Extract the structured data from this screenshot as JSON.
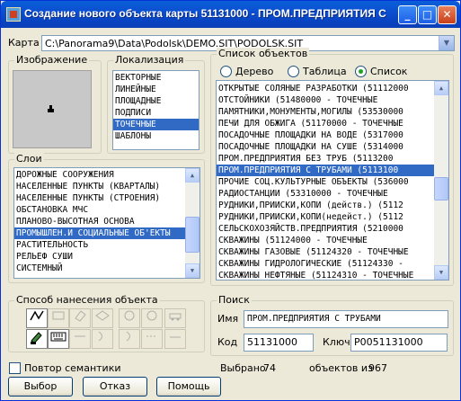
{
  "window": {
    "title": "Создание нового объекта карты 51131000 - ПРОМ.ПРЕДПРИЯТИЯ С ..."
  },
  "map": {
    "label": "Карта",
    "value": "C:\\Panorama9\\Data\\Podolsk\\DEMO.SIT\\PODOLSK.SIT"
  },
  "image_group": {
    "title": "Изображение"
  },
  "localization": {
    "title": "Локализация",
    "items": [
      "ВЕКТОРНЫЕ",
      "ЛИНЕЙНЫЕ",
      "ПЛОЩАДНЫЕ",
      "ПОДПИСИ",
      "ТОЧЕЧНЫЕ",
      "ШАБЛОНЫ"
    ],
    "selected_index": 4
  },
  "layers": {
    "title": "Слои",
    "items": [
      "ДОРОЖНЫЕ СООРУЖЕНИЯ",
      "НАСЕЛЕННЫЕ ПУНКТЫ (КВАРТАЛЫ)",
      "НАСЕЛЕННЫЕ ПУНКТЫ (СТРОЕНИЯ)",
      "ОБСТАНОВКА МЧС",
      "ПЛАНОВО-ВЫСОТНАЯ ОСНОВА",
      "ПРОМЫШЛЕН.И СОЦИАЛЬНЫЕ ОБ'ЕКТЫ",
      "РАСТИТЕЛЬНОСТЬ",
      "РЕЛЬЕФ СУШИ",
      "СИСТЕМНЫЙ"
    ],
    "selected_index": 5
  },
  "objects": {
    "title": "Список объектов",
    "radios": [
      "Дерево",
      "Таблица",
      "Список"
    ],
    "selected_radio": 2,
    "items": [
      "ОТКРЫТЫЕ СОЛЯНЫЕ РАЗРАБОТКИ (51112000",
      "ОТСТОЙНИКИ (51480000 - ТОЧЕЧНЫЕ",
      "ПАМЯТНИКИ,МОНУМЕНТЫ,МОГИЛЫ (53530000",
      "ПЕЧИ ДЛЯ ОБЖИГА (51170000 - ТОЧЕЧНЫЕ",
      "ПОСАДОЧНЫЕ ПЛОЩАДКИ НА ВОДЕ  (5317000",
      "ПОСАДОЧНЫЕ ПЛОЩАДКИ НА СУШЕ  (5314000",
      "ПРОМ.ПРЕДПРИЯТИЯ БЕЗ ТРУБ  (5113200",
      "ПРОМ.ПРЕДПРИЯТИЯ С ТРУБАМИ  (5113100",
      "ПРОЧИЕ СОЦ.КУЛЬТУРНЫЕ ОБЪЕКТЫ (536000",
      "РАДИОСТАНЦИИ   (53310000 - ТОЧЕЧНЫЕ",
      "РУДНИКИ,ПРИИСКИ,КОПИ (действ.) (5112",
      "РУДНИКИ,ПРИИСКИ,КОПИ(недейст.) (5112",
      "СЕЛЬСКОХОЗЯЙСТВ.ПРЕДПРИЯТИЯ (5210000",
      "СКВАЖИНЫ  (51124000 - ТОЧЕЧНЫЕ",
      "СКВАЖИНЫ ГАЗОВЫЕ  (51124320 - ТОЧЕЧНЫЕ",
      "СКВАЖИНЫ ГИДРОЛОГИЧЕСКИЕ (51124330 -",
      "СКВАЖИНЫ НЕФТЯНЫЕ  (51124310 - ТОЧЕЧНЫЕ"
    ],
    "selected_index": 7
  },
  "method": {
    "title": "Способ нанесения объекта"
  },
  "search": {
    "title": "Поиск",
    "name_label": "Имя",
    "name_value": "ПРОМ.ПРЕДПРИЯТИЯ С ТРУБАМИ",
    "code_label": "Код",
    "code_value": "51131000",
    "key_label": "Ключ",
    "key_value": "P0051131000"
  },
  "footer": {
    "repeat_semantics": "Повтор семантики",
    "selected_label": "Выбрано",
    "selected_count": "74",
    "total_label": "объектов из",
    "total_count": "967",
    "btn_select": "Выбор",
    "btn_cancel": "Отказ",
    "btn_help": "Помощь"
  }
}
